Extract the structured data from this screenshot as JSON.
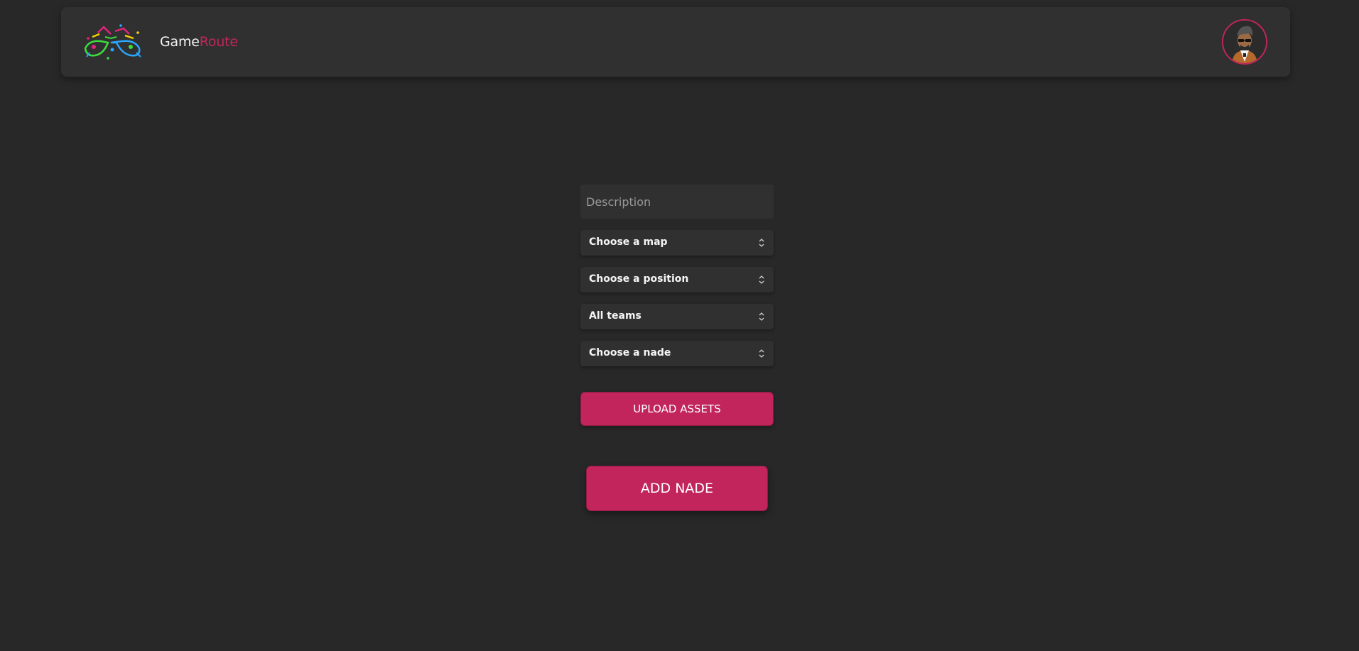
{
  "header": {
    "logo_icon": "game-controllers-logo",
    "brand_part1": "Game",
    "brand_part2": "Route",
    "avatar_icon": "user-avatar-cartoon"
  },
  "form": {
    "description_placeholder": "Description",
    "description_value": "",
    "map_select": "Choose a map",
    "position_select": "Choose a position",
    "team_select": "All teams",
    "nade_select": "Choose a nade",
    "upload_label": "UPLOAD ASSETS",
    "submit_label": "ADD NADE"
  },
  "colors": {
    "background": "#282828",
    "navbar": "#303030",
    "field": "#303030",
    "accent": "#c2255c",
    "text": "#f5f5f5"
  }
}
